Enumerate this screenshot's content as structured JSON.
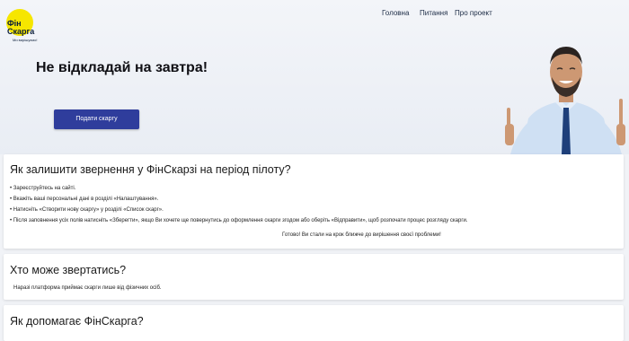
{
  "logo": {
    "line1": "Фін",
    "line2": "Скарга",
    "tagline": "Ми вирішуємо!"
  },
  "nav": {
    "items": [
      "Головна",
      "Питання",
      "Про проект"
    ]
  },
  "hero": {
    "title": "Не відкладай на завтра!",
    "cta_label": "Подати скаргу"
  },
  "section_how": {
    "title": "Як залишити звернення у ФінСкарзі на період пілоту?",
    "steps": [
      "• Зареєструйтесь на сайті.",
      "• Вкажіть ваші персональні дані в розділі «Налаштування».",
      "• Натисніть «Створити нову скаргу» у розділі «Список скарг».",
      "• Після заповнення усіх полів натисніть «Зберегти», якщо Ви хочете ще повернутись до оформлення скарги згодом або оберіть «Відправити», щоб розпочати процес розгляду скарги."
    ],
    "closing": "Готово! Ви стали на крок ближче до вирішення своєї проблеми!"
  },
  "section_who": {
    "title": "Хто може звертатись?",
    "text": "Наразі платформа приймає скарги лише від фізичних осіб."
  },
  "section_help": {
    "title": "Як допомагає ФінСкарга?"
  },
  "colors": {
    "cta": "#2f3d9c",
    "logo_yellow": "#f6e600",
    "page_bg": "#f1f3f7"
  }
}
